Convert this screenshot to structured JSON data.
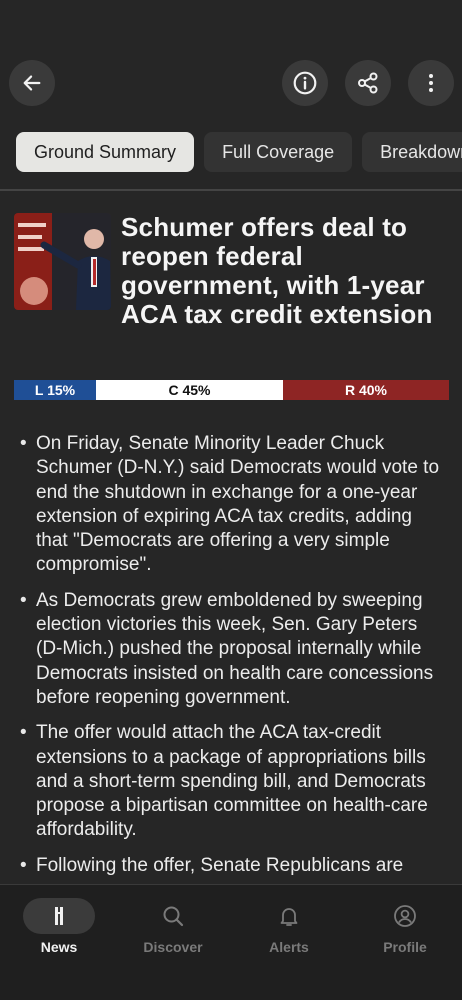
{
  "toolbar": {
    "back_icon": "arrow-left-icon",
    "info_icon": "info-icon",
    "share_icon": "share-icon",
    "more_icon": "more-vertical-icon"
  },
  "tabs": [
    {
      "label": "Ground Summary",
      "active": true
    },
    {
      "label": "Full Coverage",
      "active": false
    },
    {
      "label": "Breakdown",
      "active": false
    }
  ],
  "article": {
    "headline": "Schumer offers deal to reopen federal government, with 1-year ACA tax credit extension"
  },
  "bias": {
    "left": {
      "label": "L 15%",
      "percent": 15,
      "color": "#1f4f96"
    },
    "center": {
      "label": "C 45%",
      "percent": 45,
      "color": "#ffffff"
    },
    "right": {
      "label": "R 40%",
      "percent": 40,
      "color": "#8e2524"
    }
  },
  "summary": [
    "On Friday, Senate Minority Leader Chuck Schumer (D-N.Y.) said Democrats would vote to end the shutdown in exchange for a one-year extension of expiring ACA tax credits, adding that \"Democrats are offering a very simple compromise\".",
    "As Democrats grew emboldened by sweeping election victories this week, Sen. Gary Peters (D-Mich.) pushed the proposal internally while Democrats insisted on health care concessions before reopening government.",
    "The offer would attach the ACA tax-credit extensions to a package of appropriations bills and a short-term spending bill, and Democrats propose a bipartisan committee on health-care affordability.",
    "Following the offer, Senate Republicans are"
  ],
  "bottom_nav": [
    {
      "label": "News",
      "icon": "news-logo-icon",
      "active": true
    },
    {
      "label": "Discover",
      "icon": "search-icon",
      "active": false
    },
    {
      "label": "Alerts",
      "icon": "bell-icon",
      "active": false
    },
    {
      "label": "Profile",
      "icon": "profile-icon",
      "active": false
    }
  ]
}
